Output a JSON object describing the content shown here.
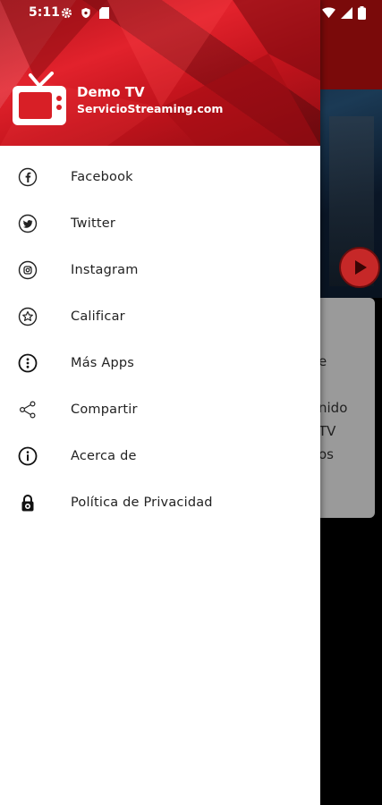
{
  "status_bar": {
    "time": "5:11"
  },
  "drawer": {
    "app_name": "Demo TV",
    "app_url": "ServicioStreaming.com",
    "items": [
      {
        "label": "Facebook",
        "icon": "facebook-icon"
      },
      {
        "label": "Twitter",
        "icon": "twitter-icon"
      },
      {
        "label": "Instagram",
        "icon": "instagram-icon"
      },
      {
        "label": "Calificar",
        "icon": "star-icon"
      },
      {
        "label": "Más Apps",
        "icon": "more-apps-icon"
      },
      {
        "label": "Compartir",
        "icon": "share-icon"
      },
      {
        "label": "Acerca de",
        "icon": "info-icon"
      },
      {
        "label": "Política de Privacidad",
        "icon": "lock-icon"
      }
    ]
  },
  "background": {
    "card_lines": [
      "e",
      "nido",
      "TV",
      "os"
    ]
  },
  "colors": {
    "brand_red": "#d81f26",
    "header_dark": "#7a0a0a",
    "play_red": "#c62828"
  }
}
